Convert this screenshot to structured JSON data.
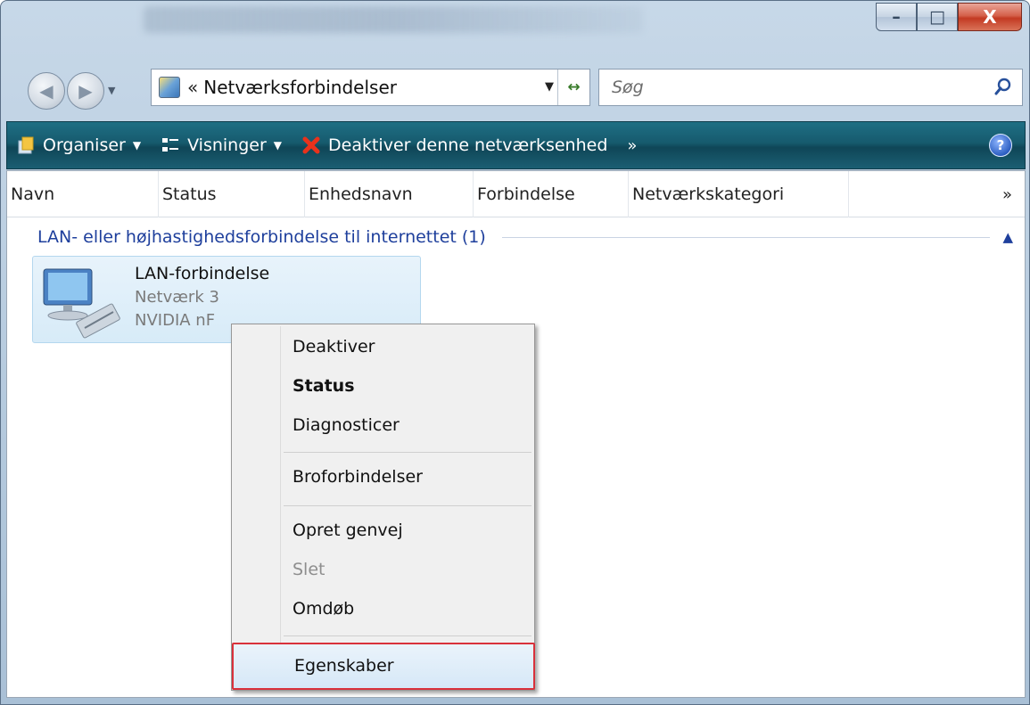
{
  "window": {
    "controls": {
      "minimize": "–",
      "maximize": "□",
      "close": "X"
    }
  },
  "address": {
    "chevron": "«",
    "path": "Netværksforbindelser",
    "search_placeholder": "Søg"
  },
  "toolbar": {
    "organise": "Organiser",
    "views": "Visninger",
    "disable": "Deaktiver denne netværksenhed",
    "more": "»",
    "help": "?"
  },
  "columns": [
    "Navn",
    "Status",
    "Enhedsnavn",
    "Forbindelse",
    "Netværkskategori"
  ],
  "columns_more": "»",
  "group": {
    "label": "LAN- eller højhastighedsforbindelse til internettet (1)"
  },
  "item": {
    "name": "LAN-forbindelse",
    "network": "Netværk 3",
    "device": "NVIDIA nF"
  },
  "context_menu": {
    "items": [
      "Deaktiver",
      "Status",
      "Diagnosticer",
      "Broforbindelser",
      "Opret genvej",
      "Slet",
      "Omdøb",
      "Egenskaber"
    ],
    "selected": "Egenskaber"
  },
  "colors": {
    "toolbar": "#165a6d",
    "group_text": "#1e3f9c",
    "highlight_border": "#d9313b"
  }
}
